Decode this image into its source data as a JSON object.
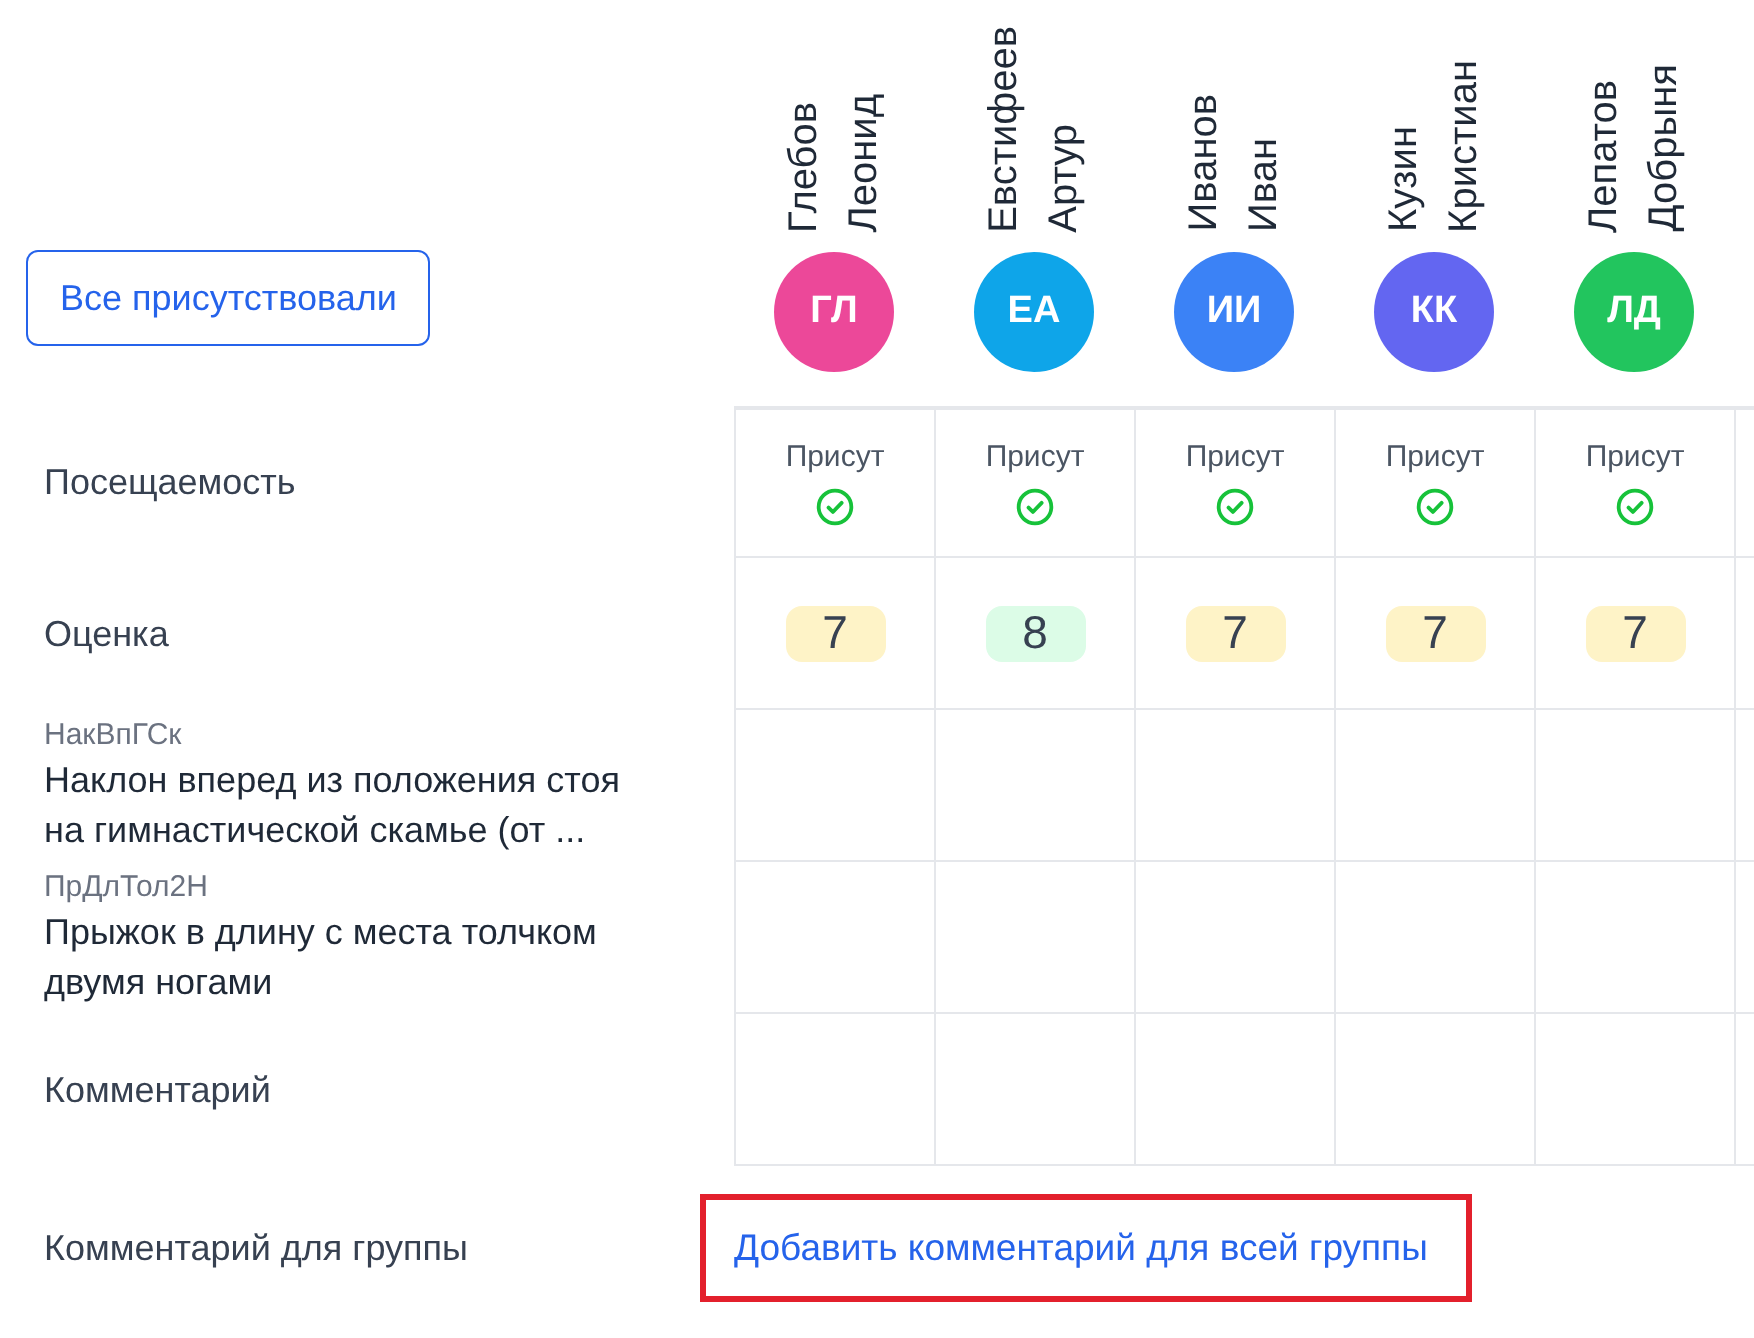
{
  "toolbar": {
    "all_present_button": "Все присутствовали"
  },
  "students": [
    {
      "last_name": "Глебов",
      "first_name": "Леонид",
      "initials": "ГЛ",
      "color": "#ec4899",
      "attendance": {
        "label": "Присут",
        "present": true
      },
      "grade": {
        "value": "7",
        "color": "#fef3c7"
      }
    },
    {
      "last_name": "Евстифеев",
      "first_name": "Артур",
      "initials": "ЕА",
      "color": "#0ea5e9",
      "attendance": {
        "label": "Присут",
        "present": true
      },
      "grade": {
        "value": "8",
        "color": "#dcfce7"
      }
    },
    {
      "last_name": "Иванов",
      "first_name": "Иван",
      "initials": "ИИ",
      "color": "#3b82f6",
      "attendance": {
        "label": "Присут",
        "present": true
      },
      "grade": {
        "value": "7",
        "color": "#fef3c7"
      }
    },
    {
      "last_name": "Кузин",
      "first_name": "Кристиан",
      "initials": "КК",
      "color": "#6366f1",
      "attendance": {
        "label": "Присут",
        "present": true
      },
      "grade": {
        "value": "7",
        "color": "#fef3c7"
      }
    },
    {
      "last_name": "Лепатов",
      "first_name": "Добрыня",
      "initials": "ЛД",
      "color": "#22c55e",
      "attendance": {
        "label": "Присут",
        "present": true
      },
      "grade": {
        "value": "7",
        "color": "#fef3c7"
      }
    }
  ],
  "rows": [
    {
      "kind": "attendance",
      "label": "Посещаемость"
    },
    {
      "kind": "grade",
      "label": "Оценка"
    },
    {
      "kind": "exercise",
      "code": "НакВпГСк",
      "label": "Наклон вперед из положения стоя на гимнастической скамье (от ..."
    },
    {
      "kind": "exercise",
      "code": "ПрДлТол2Н",
      "label": "Прыжок в длину с места толчком двумя ногами"
    },
    {
      "kind": "comment",
      "label": "Комментарий"
    }
  ],
  "group_comment": {
    "label": "Комментарий для группы",
    "link": "Добавить комментарий для всей группы",
    "highlighted": true
  }
}
